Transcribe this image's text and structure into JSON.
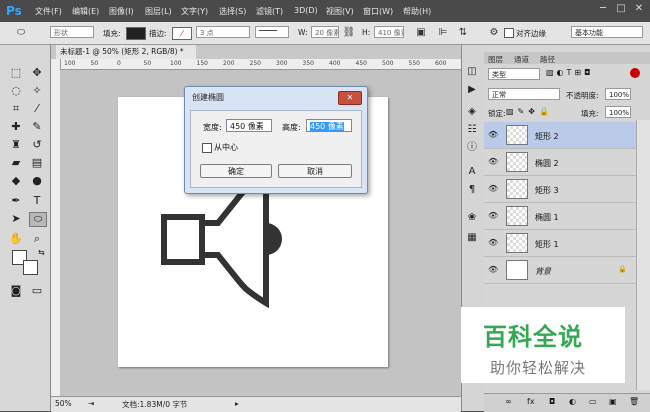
{
  "app": {
    "logo": "Ps"
  },
  "menu": [
    "文件(F)",
    "编辑(E)",
    "图像(I)",
    "图层(L)",
    "文字(Y)",
    "选择(S)",
    "滤镜(T)",
    "3D(D)",
    "视图(V)",
    "窗口(W)",
    "帮助(H)"
  ],
  "window_controls": [
    "─",
    "□",
    "✕"
  ],
  "options": {
    "mode": "形状",
    "fill_label": "填充:",
    "stroke_label": "描边:",
    "stroke_size": "3 点",
    "w_label": "W:",
    "w_value": "20 像素",
    "h_label": "H:",
    "h_value": "410 像素",
    "align_edges": "对齐边缘",
    "workspace": "基本功能"
  },
  "document": {
    "tab_title": "未标题-1 @ 50% (矩形 2, RGB/8) *",
    "ruler_numbers": [
      "100",
      "50",
      "0",
      "50",
      "100",
      "150",
      "200",
      "250",
      "300",
      "350",
      "400",
      "450",
      "500",
      "550",
      "600"
    ]
  },
  "dialog": {
    "title": "创建椭圆",
    "close": "✕",
    "width_label": "宽度:",
    "width_value": "450 像素",
    "height_label": "高度:",
    "height_value": "450 像素",
    "from_center": "从中心",
    "ok": "确定",
    "cancel": "取消"
  },
  "status": {
    "zoom": "50%",
    "doc_info": "文档:1.83M/0 字节"
  },
  "layers_panel": {
    "tabs": [
      "图层",
      "通道",
      "路径"
    ],
    "filter": "类型",
    "blend_mode": "正常",
    "opacity_label": "不透明度:",
    "opacity_value": "100%",
    "lock_label": "锁定:",
    "fill_label": "填充:",
    "fill_value": "100%",
    "layers": [
      {
        "name": "矩形 2",
        "selected": true
      },
      {
        "name": "椭圆 2",
        "selected": false
      },
      {
        "name": "矩形 3",
        "selected": false
      },
      {
        "name": "椭圆 1",
        "selected": false
      },
      {
        "name": "矩形 1",
        "selected": false
      },
      {
        "name": "背景",
        "selected": false
      }
    ],
    "bottom_icons": [
      "∞",
      "fx",
      "◘",
      "◐",
      "▭",
      "▣",
      "🗑"
    ]
  },
  "watermark": {
    "main": "百科全说",
    "sub": "助你轻松解决"
  },
  "colors": {
    "accent": "#31a8ff",
    "selected_layer": "#b9cbe8",
    "watermark_green": "#34a853"
  }
}
